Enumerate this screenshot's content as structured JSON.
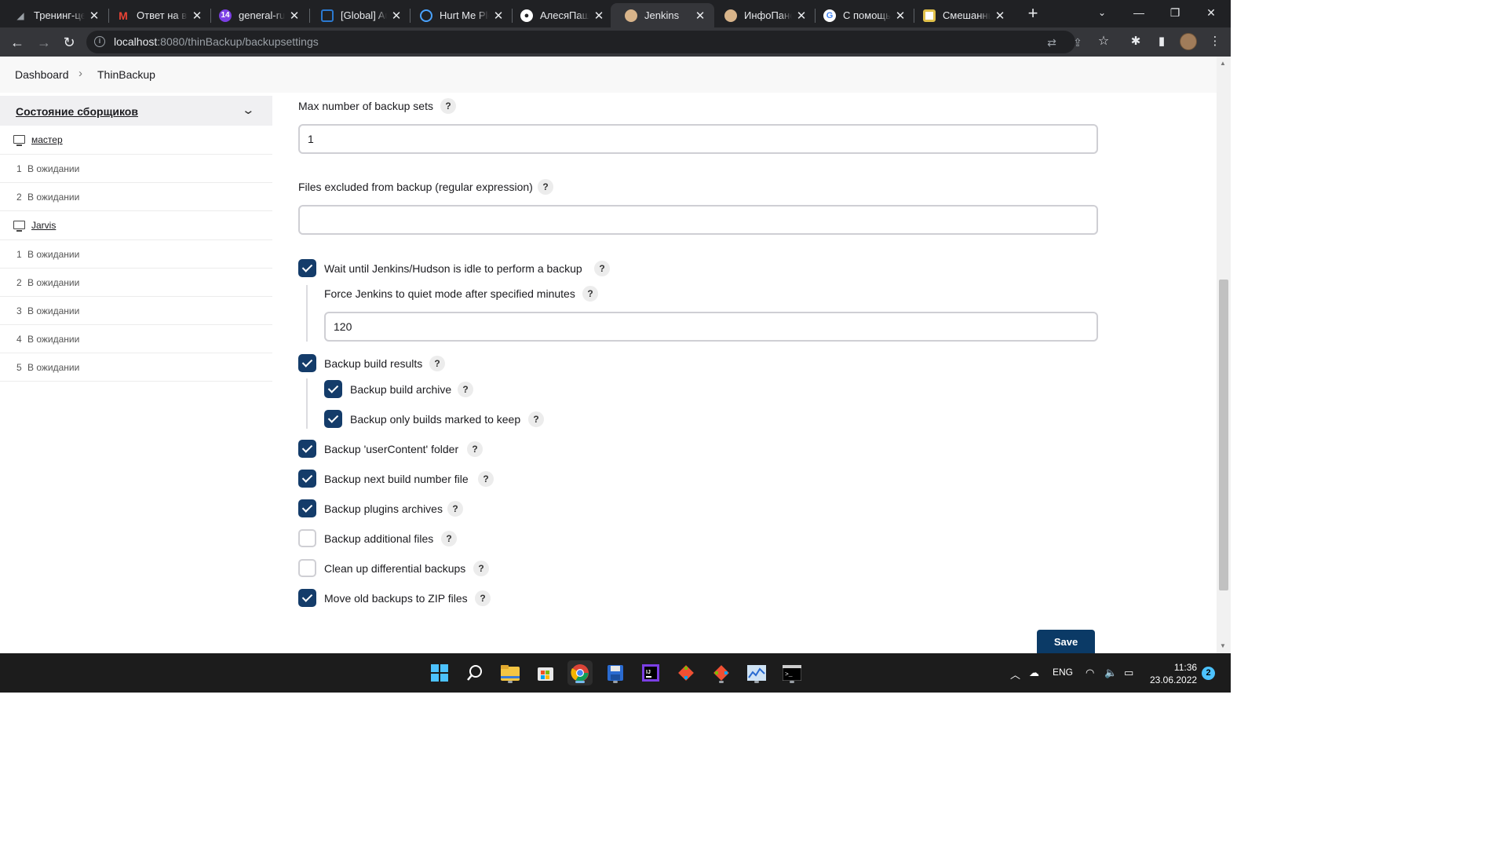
{
  "browser": {
    "tabs": [
      {
        "title": "Тренинг-це",
        "icon": "triangle-icon",
        "color": "#5f6368"
      },
      {
        "title": "Ответ на в",
        "icon": "gmail-icon",
        "color": "#ea4335"
      },
      {
        "title": "general-ru",
        "icon": "chat-14-icon",
        "color": "#7b3fe4",
        "badge": "14"
      },
      {
        "title": "[Global] Au",
        "icon": "window-icon",
        "color": "#2b79d0"
      },
      {
        "title": "Hurt Me Ple",
        "icon": "ring-icon",
        "color": "#4aa3ff"
      },
      {
        "title": "АлесяПаш",
        "icon": "github-icon",
        "color": "#ffffff"
      },
      {
        "title": "Jenkins",
        "icon": "jenkins-icon",
        "color": "#d8b48a",
        "active": true
      },
      {
        "title": "ИнфоПане",
        "icon": "jenkins-icon",
        "color": "#d8b48a"
      },
      {
        "title": "С помощь",
        "icon": "google-icon",
        "color": "#4285f4"
      },
      {
        "title": "Смешанны",
        "icon": "document-icon",
        "color": "#e0c04a"
      }
    ],
    "url_host": "localhost",
    "url_path": ":8080/thinBackup/backupsettings"
  },
  "breadcrumbs": [
    "Dashboard",
    "ThinBackup"
  ],
  "sidebar": {
    "title": "Состояние сборщиков",
    "nodes": [
      {
        "name": "мастер",
        "executors": [
          {
            "num": "1",
            "status": "В ожидании"
          },
          {
            "num": "2",
            "status": "В ожидании"
          }
        ]
      },
      {
        "name": "Jarvis",
        "executors": [
          {
            "num": "1",
            "status": "В ожидании"
          },
          {
            "num": "2",
            "status": "В ожидании"
          },
          {
            "num": "3",
            "status": "В ожидании"
          },
          {
            "num": "4",
            "status": "В ожидании"
          },
          {
            "num": "5",
            "status": "В ожидании"
          }
        ]
      }
    ]
  },
  "form": {
    "max_sets_label": "Max number of backup sets",
    "max_sets_value": "1",
    "excluded_label": "Files excluded from backup (regular expression)",
    "excluded_value": "",
    "wait_idle_label": "Wait until Jenkins/Hudson is idle to perform a backup",
    "wait_idle_checked": true,
    "force_quiet_label": "Force Jenkins to quiet mode after specified minutes",
    "force_quiet_value": "120",
    "build_results_label": "Backup build results",
    "build_results_checked": true,
    "build_archive_label": "Backup build archive",
    "build_archive_checked": true,
    "builds_keep_label": "Backup only builds marked to keep",
    "builds_keep_checked": true,
    "user_content_label": "Backup 'userContent' folder",
    "user_content_checked": true,
    "next_build_label": "Backup next build number file",
    "next_build_checked": true,
    "plugins_label": "Backup plugins archives",
    "plugins_checked": true,
    "additional_label": "Backup additional files",
    "additional_checked": false,
    "cleanup_label": "Clean up differential backups",
    "cleanup_checked": false,
    "zip_label": "Move old backups to ZIP files",
    "zip_checked": true,
    "help_label": "?",
    "save_label": "Save"
  },
  "taskbar": {
    "lang": "ENG",
    "time": "11:36",
    "date": "23.06.2022",
    "notifications": "2"
  },
  "colors": {
    "accent": "#143c6a",
    "save_button": "#0b3a66"
  }
}
